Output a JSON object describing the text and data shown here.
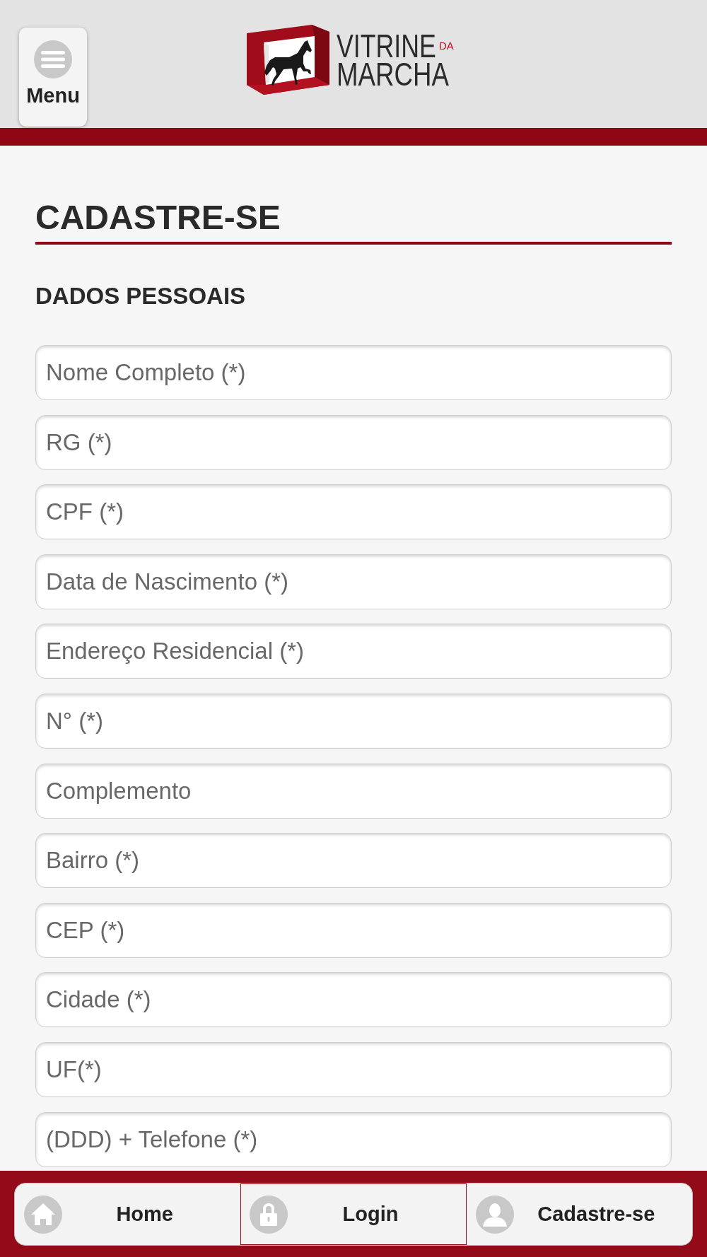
{
  "header": {
    "menu_button": {
      "label": "Menu"
    },
    "logo": {
      "line_1": "VITRINE",
      "small_word": "DA",
      "line_2": "MARCHA"
    }
  },
  "page": {
    "title": "CADASTRE-SE",
    "section": "DADOS PESSOAIS",
    "fields": [
      {
        "placeholder": "Nome Completo (*)"
      },
      {
        "placeholder": "RG (*)"
      },
      {
        "placeholder": "CPF (*)"
      },
      {
        "placeholder": "Data de Nascimento (*)"
      },
      {
        "placeholder": "Endereço Residencial (*)"
      },
      {
        "placeholder": "N° (*)"
      },
      {
        "placeholder": "Complemento"
      },
      {
        "placeholder": "Bairro (*)"
      },
      {
        "placeholder": "CEP (*)"
      },
      {
        "placeholder": "Cidade (*)"
      },
      {
        "placeholder": "UF(*)"
      },
      {
        "placeholder": "(DDD) + Telefone (*)"
      }
    ]
  },
  "footer_nav": [
    {
      "label": "Home",
      "kind": "home",
      "selected": false
    },
    {
      "label": "Login",
      "kind": "lock",
      "selected": true
    },
    {
      "label": "Cadastre-se",
      "kind": "person",
      "selected": false
    }
  ]
}
